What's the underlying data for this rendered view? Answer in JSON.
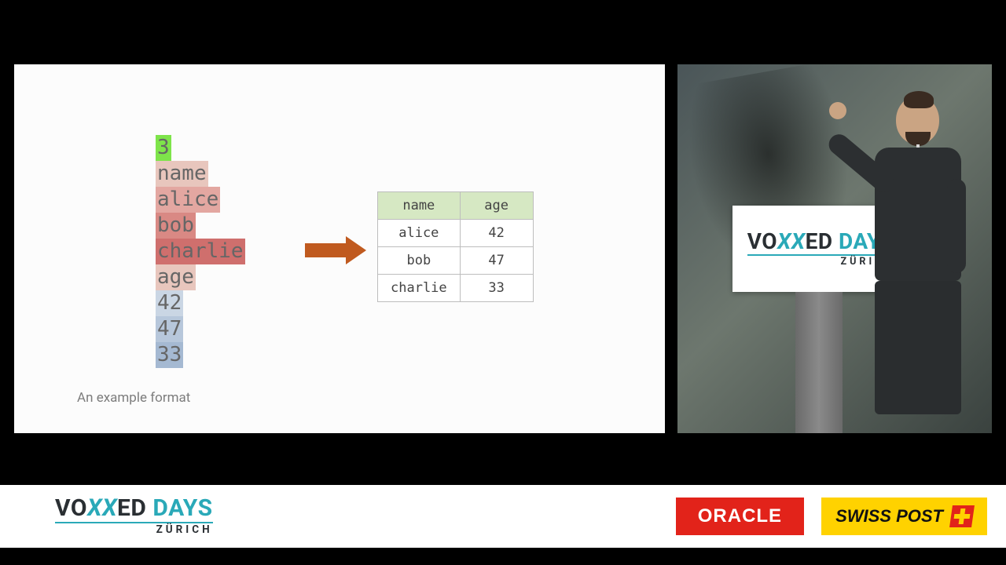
{
  "slide": {
    "caption": "An example format",
    "format_lines": [
      {
        "text": "3",
        "class": "hl-count"
      },
      {
        "text": "name",
        "class": "hl-hdr"
      },
      {
        "text": "alice",
        "class": "hl-row1"
      },
      {
        "text": "bob",
        "class": "hl-row2"
      },
      {
        "text": "charlie",
        "class": "hl-row3"
      },
      {
        "text": "age",
        "class": "hl-hdr"
      },
      {
        "text": "42",
        "class": "hl-age1"
      },
      {
        "text": "47",
        "class": "hl-age2"
      },
      {
        "text": "33",
        "class": "hl-age3"
      }
    ],
    "table": {
      "headers": [
        "name",
        "age"
      ],
      "rows": [
        [
          "alice",
          "42"
        ],
        [
          "bob",
          "47"
        ],
        [
          "charlie",
          "33"
        ]
      ]
    }
  },
  "event_logo": {
    "word1_a": "VO",
    "word1_b": "XX",
    "word1_c": "ED",
    "word2": "DAYS",
    "subline": "ZÜRICH"
  },
  "sponsors": {
    "oracle": "ORACLE",
    "swisspost": "SWISS POST"
  },
  "chart_data": {
    "type": "table",
    "title": "An example format",
    "headers": [
      "name",
      "age"
    ],
    "rows": [
      {
        "name": "alice",
        "age": 42
      },
      {
        "name": "bob",
        "age": 47
      },
      {
        "name": "charlie",
        "age": 33
      }
    ],
    "raw_format_stream": [
      "3",
      "name",
      "alice",
      "bob",
      "charlie",
      "age",
      "42",
      "47",
      "33"
    ]
  }
}
